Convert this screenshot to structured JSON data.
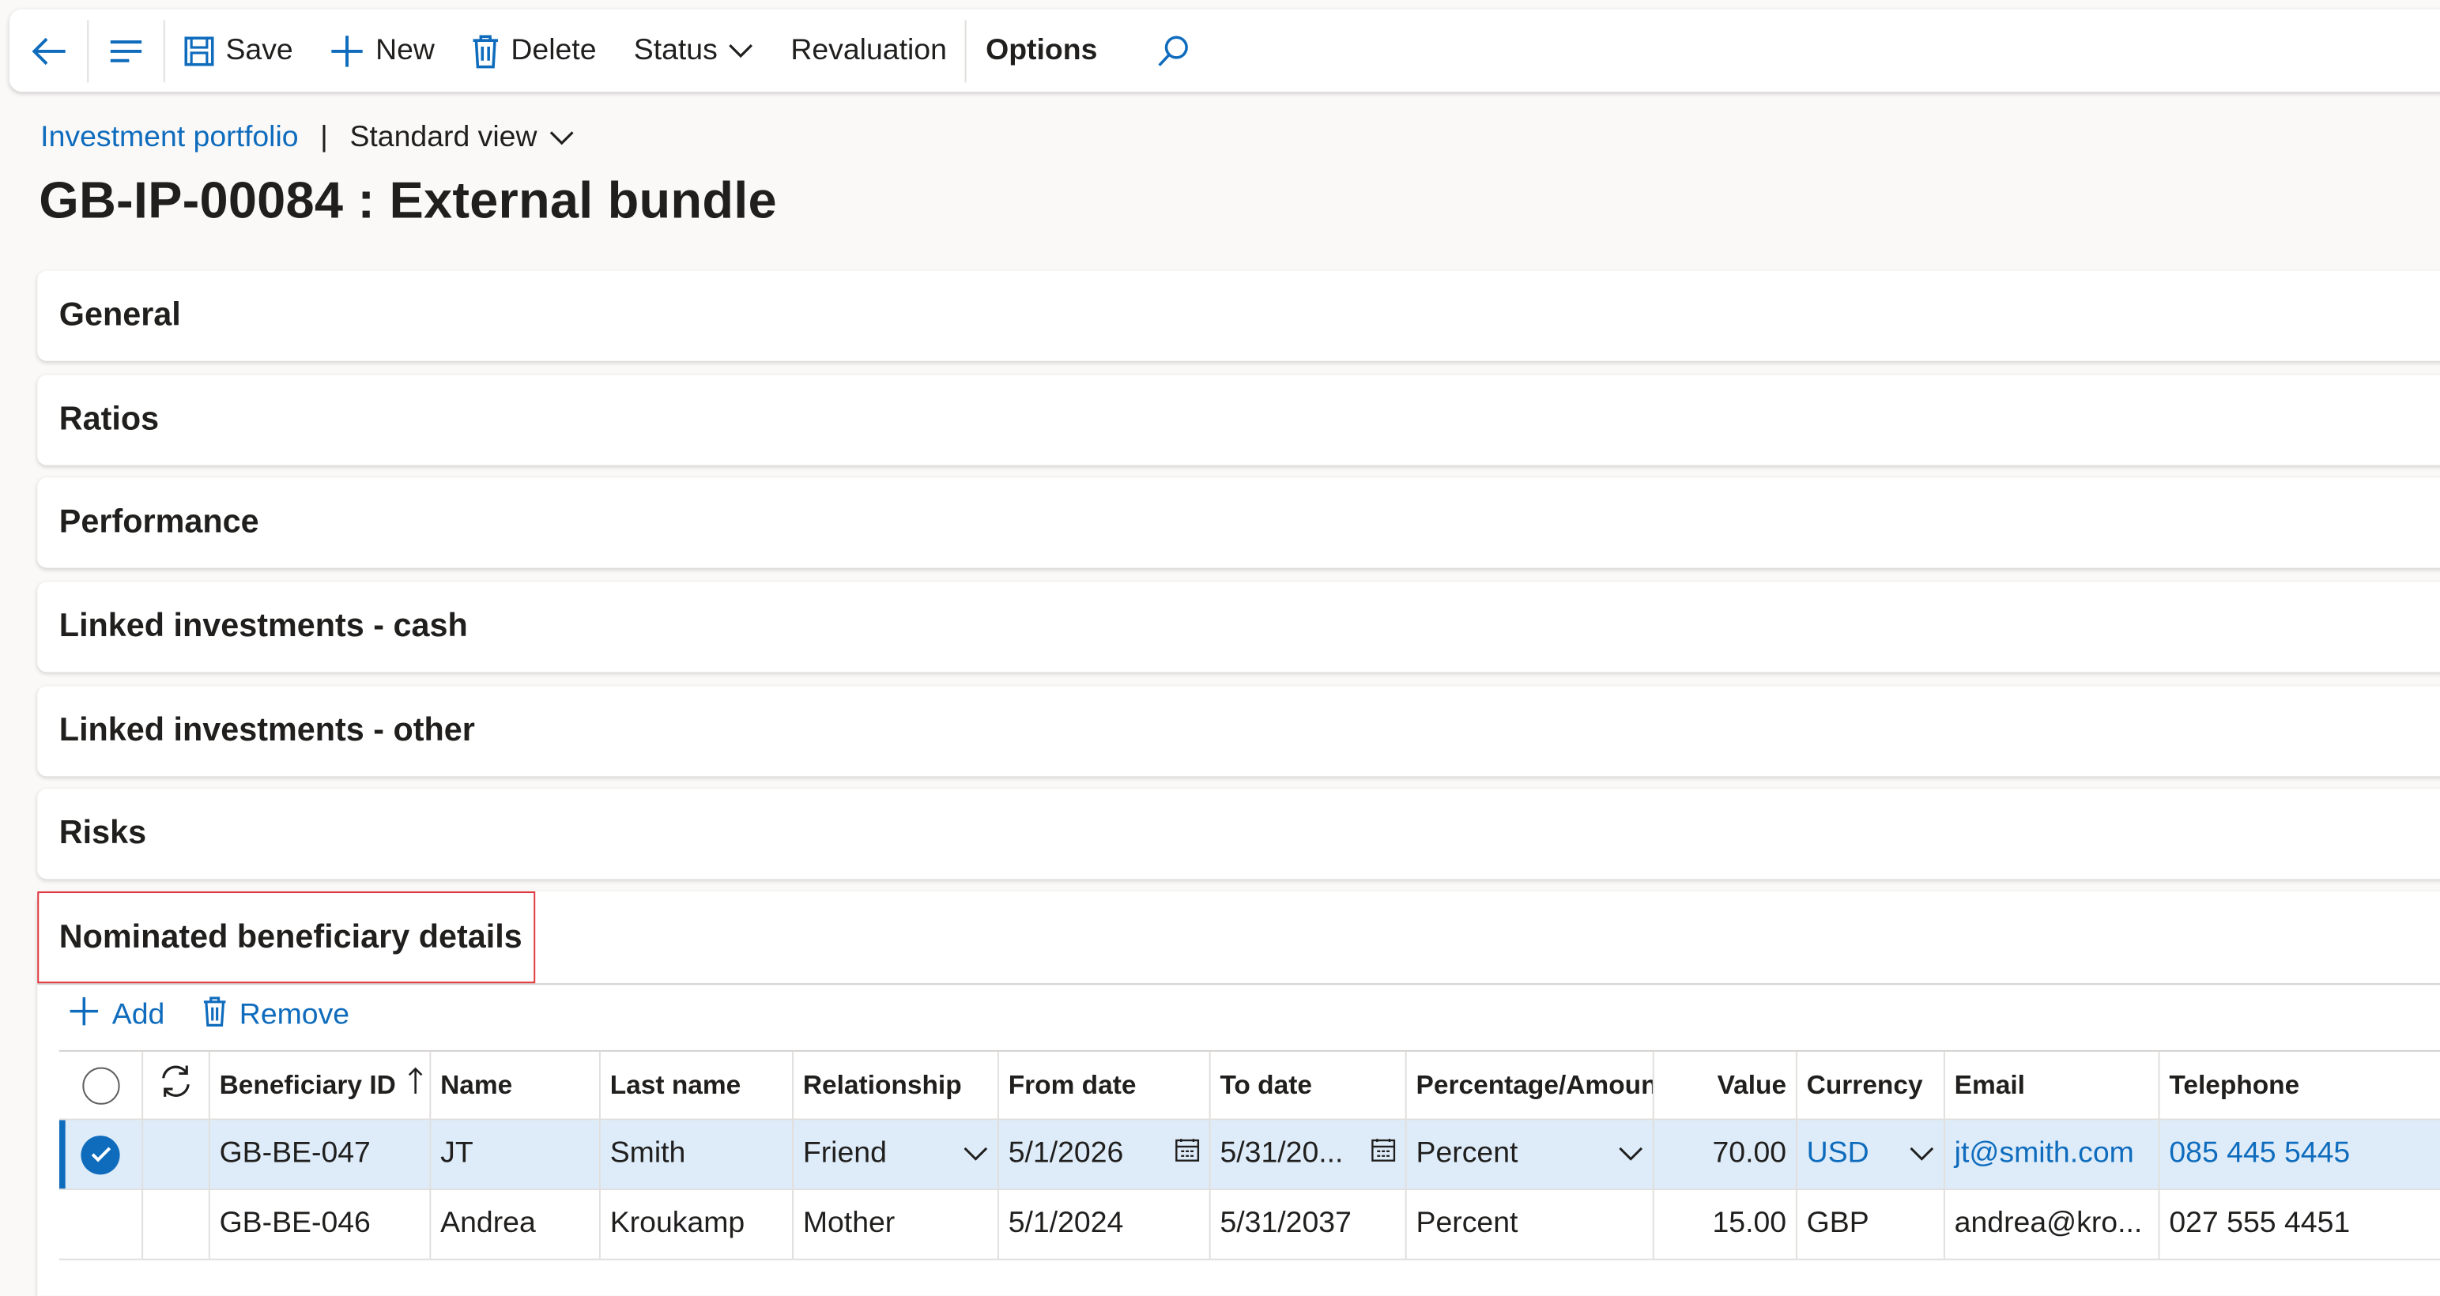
{
  "toolbar": {
    "save": "Save",
    "new": "New",
    "delete": "Delete",
    "status": "Status",
    "revaluation": "Revaluation",
    "options": "Options"
  },
  "breadcrumb": {
    "link": "Investment portfolio",
    "separator": "|",
    "view": "Standard view"
  },
  "page_title": "GB-IP-00084 : External bundle",
  "sections": [
    "General",
    "Ratios",
    "Performance",
    "Linked investments - cash",
    "Linked investments - other",
    "Risks"
  ],
  "beneficiary": {
    "title": "Nominated beneficiary details",
    "add": "Add",
    "remove": "Remove",
    "columns": [
      "Beneficiary ID",
      "Name",
      "Last name",
      "Relationship",
      "From date",
      "To date",
      "Percentage/Amount",
      "Value",
      "Currency",
      "Email",
      "Telephone"
    ],
    "rows": [
      {
        "id": "GB-BE-047",
        "name": "JT",
        "last": "Smith",
        "relationship": "Friend",
        "from": "5/1/2026",
        "to": "5/31/20...",
        "pct": "Percent",
        "value": "70.00",
        "currency": "USD",
        "email": "jt@smith.com",
        "phone": "085 445 5445"
      },
      {
        "id": "GB-BE-046",
        "name": "Andrea",
        "last": "Kroukamp",
        "relationship": "Mother",
        "from": "5/1/2024",
        "to": "5/31/2037",
        "pct": "Percent",
        "value": "15.00",
        "currency": "GBP",
        "email": "andrea@kro...",
        "phone": "027 555 4451"
      }
    ]
  },
  "colors": {
    "accent": "#0f6cbd",
    "selected_row": "#deecf9",
    "highlight_box": "#e0373e"
  }
}
